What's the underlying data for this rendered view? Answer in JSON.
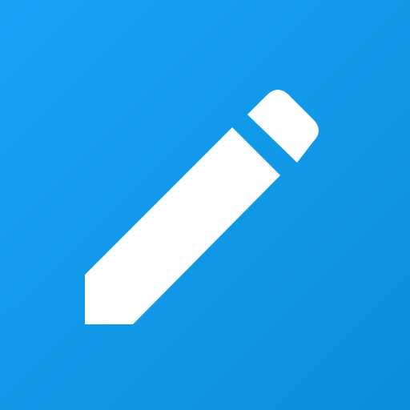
{
  "app_icon": {
    "icon": "pencil-icon",
    "colors": {
      "background_start": "#17a3f5",
      "background_end": "#0b8fdc",
      "glyph": "#ffffff"
    }
  }
}
